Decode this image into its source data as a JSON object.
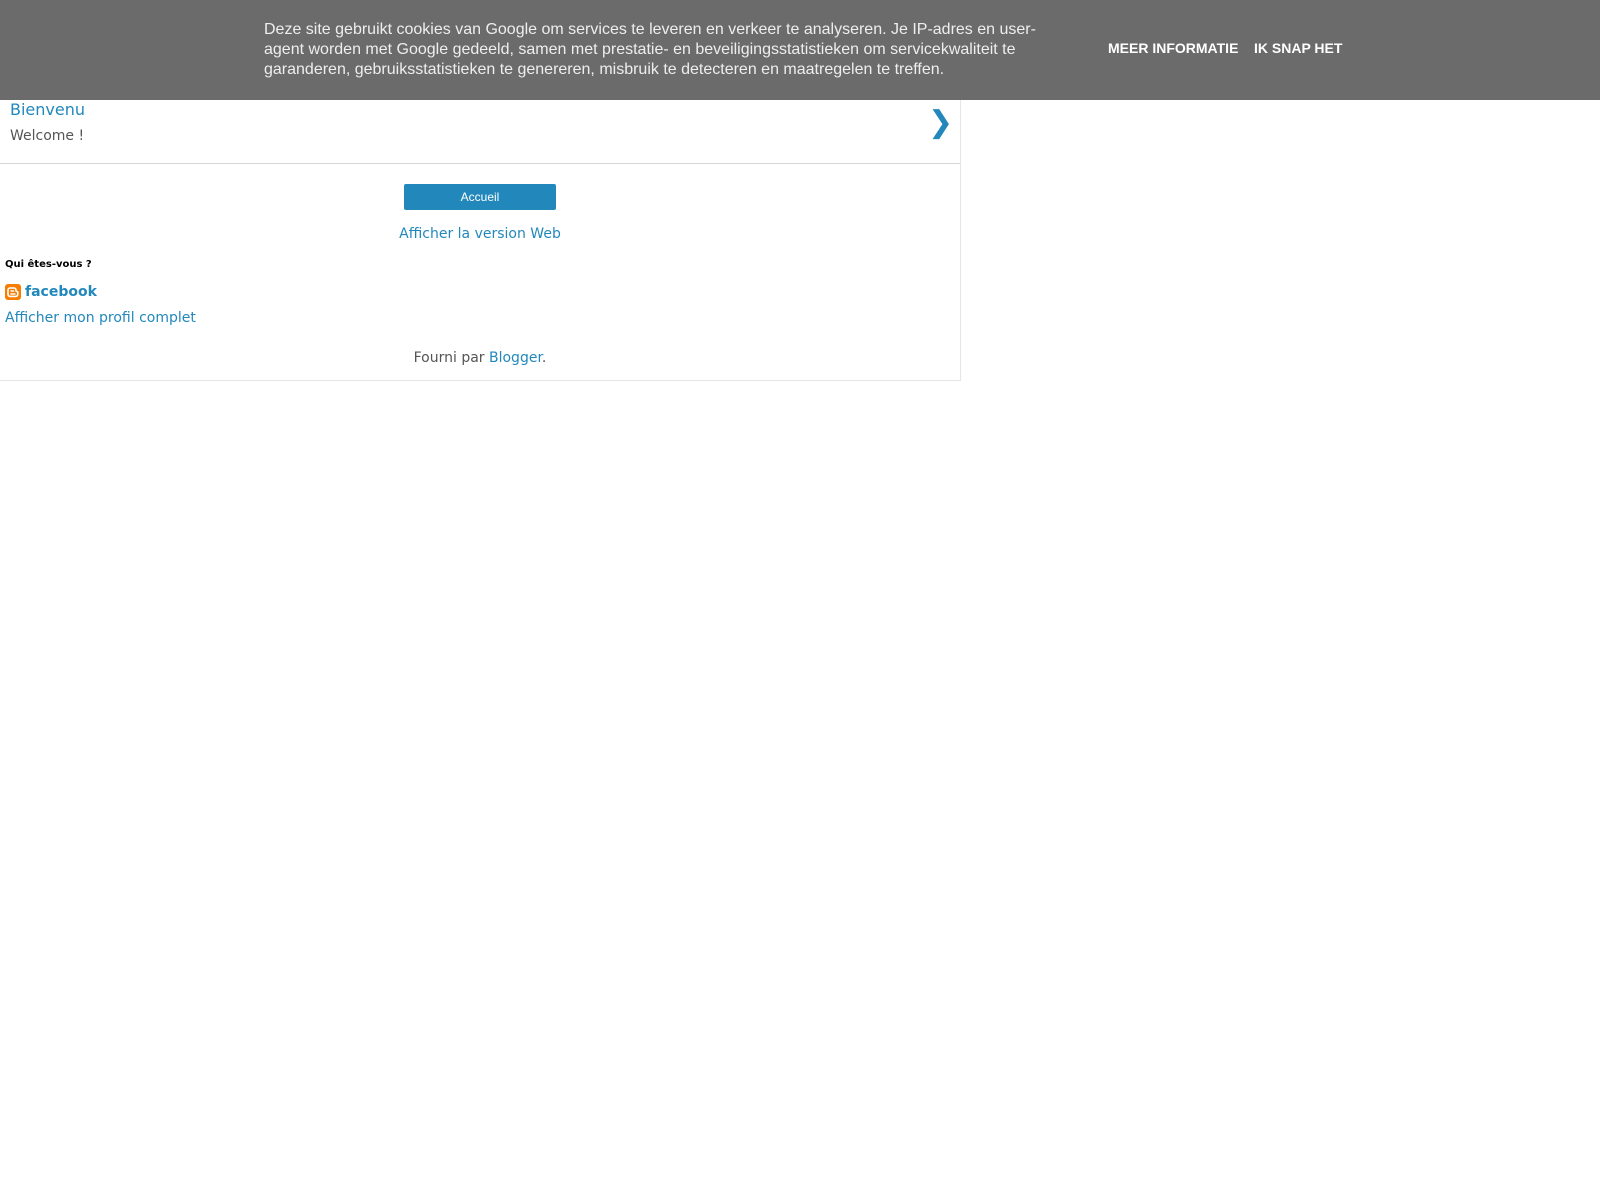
{
  "cookie_notice": {
    "text": "Deze site gebruikt cookies van Google om services te leveren en verkeer te analyseren. Je IP-adres en user-agent worden met Google gedeeld, samen met prestatie- en beveiligingsstatistieken om servicekwaliteit te garanderen, gebruiksstatistieken te genereren, misbruik te detecteren en maatregelen te treffen.",
    "more_info_label": "MEER INFORMATIE",
    "accept_label": "IK SNAP HET",
    "background_color": "#6b6b6b"
  },
  "post": {
    "title": "Bienvenu",
    "snippet": "Welcome !",
    "chevron_icon": "chevron-right-icon"
  },
  "navigation": {
    "home_button_label": "Accueil",
    "web_version_label": "Afficher la version Web"
  },
  "profile": {
    "heading": "Qui êtes-vous ?",
    "icon": "blogger-icon",
    "name": "facebook",
    "full_profile_label": "Afficher mon profil complet"
  },
  "footer": {
    "prefix": "Fourni par ",
    "link_label": "Blogger",
    "suffix": "."
  },
  "colors": {
    "accent": "#2288bb",
    "blogger_orange": "#f57d00",
    "text": "#555555"
  }
}
